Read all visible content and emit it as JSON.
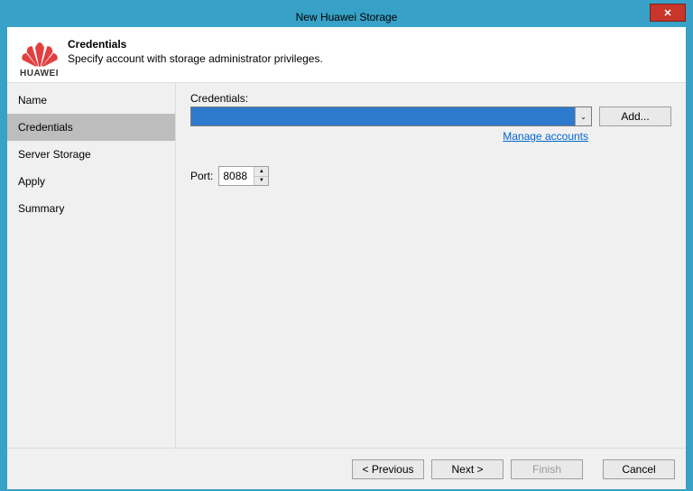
{
  "titlebar": {
    "title": "New Huawei Storage"
  },
  "header": {
    "logo_text": "HUAWEI",
    "title": "Credentials",
    "subtitle": "Specify account with storage administrator privileges."
  },
  "sidebar": {
    "items": [
      {
        "label": "Name",
        "active": false
      },
      {
        "label": "Credentials",
        "active": true
      },
      {
        "label": "Server Storage",
        "active": false
      },
      {
        "label": "Apply",
        "active": false
      },
      {
        "label": "Summary",
        "active": false
      }
    ]
  },
  "content": {
    "credentials_label": "Credentials:",
    "credentials_value": "",
    "add_label": "Add...",
    "manage_link": "Manage accounts",
    "port_label": "Port:",
    "port_value": "8088"
  },
  "footer": {
    "previous": "< Previous",
    "next": "Next >",
    "finish": "Finish",
    "cancel": "Cancel"
  }
}
